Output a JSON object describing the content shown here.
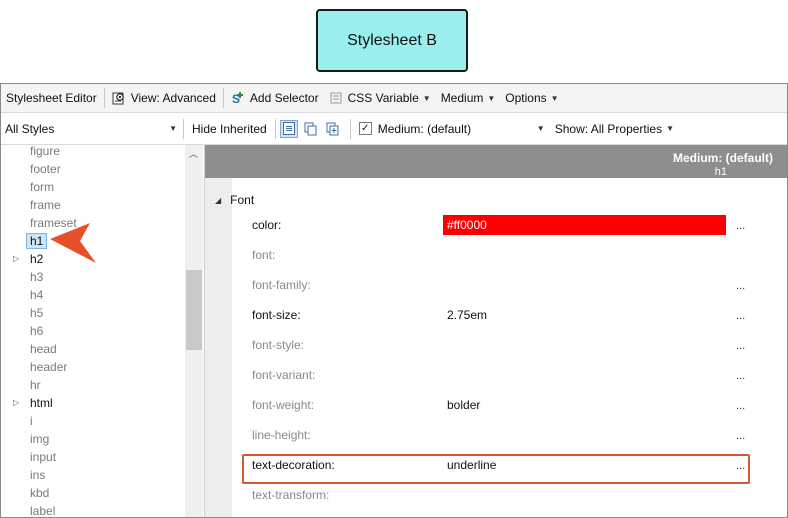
{
  "callout": {
    "label": "Stylesheet B"
  },
  "toolbar": {
    "stylesheet_editor": "Stylesheet Editor",
    "view": "View: Advanced",
    "add_selector": "Add Selector",
    "css_variable": "CSS Variable",
    "medium": "Medium",
    "options": "Options"
  },
  "filterbar": {
    "styles_select": "All Styles",
    "hide_inherited": "Hide Inherited",
    "medium_select": "Medium: (default)",
    "show_select": "Show: All Properties"
  },
  "tree": {
    "items": [
      "figure",
      "footer",
      "form",
      "frame",
      "frameset",
      "h1",
      "h2",
      "h3",
      "h4",
      "h5",
      "h6",
      "head",
      "header",
      "hr",
      "html",
      "i",
      "img",
      "input",
      "ins",
      "kbd",
      "label"
    ]
  },
  "grid": {
    "header_medium": "Medium: (default)",
    "header_selector": "h1",
    "group": "Font",
    "rows": [
      {
        "prop": "color:",
        "value": "#ff0000"
      },
      {
        "prop": "font:",
        "value": ""
      },
      {
        "prop": "font-family:",
        "value": ""
      },
      {
        "prop": "font-size:",
        "value": "2.75em"
      },
      {
        "prop": "font-style:",
        "value": ""
      },
      {
        "prop": "font-variant:",
        "value": ""
      },
      {
        "prop": "font-weight:",
        "value": "bolder"
      },
      {
        "prop": "line-height:",
        "value": ""
      },
      {
        "prop": "text-decoration:",
        "value": "underline"
      },
      {
        "prop": "text-transform:",
        "value": ""
      }
    ],
    "ellipsis": "..."
  },
  "colors": {
    "callout_bg": "#99efec",
    "color_value": "#ff0000",
    "highlight": "#d5582e",
    "pointer": "#e8502a"
  }
}
